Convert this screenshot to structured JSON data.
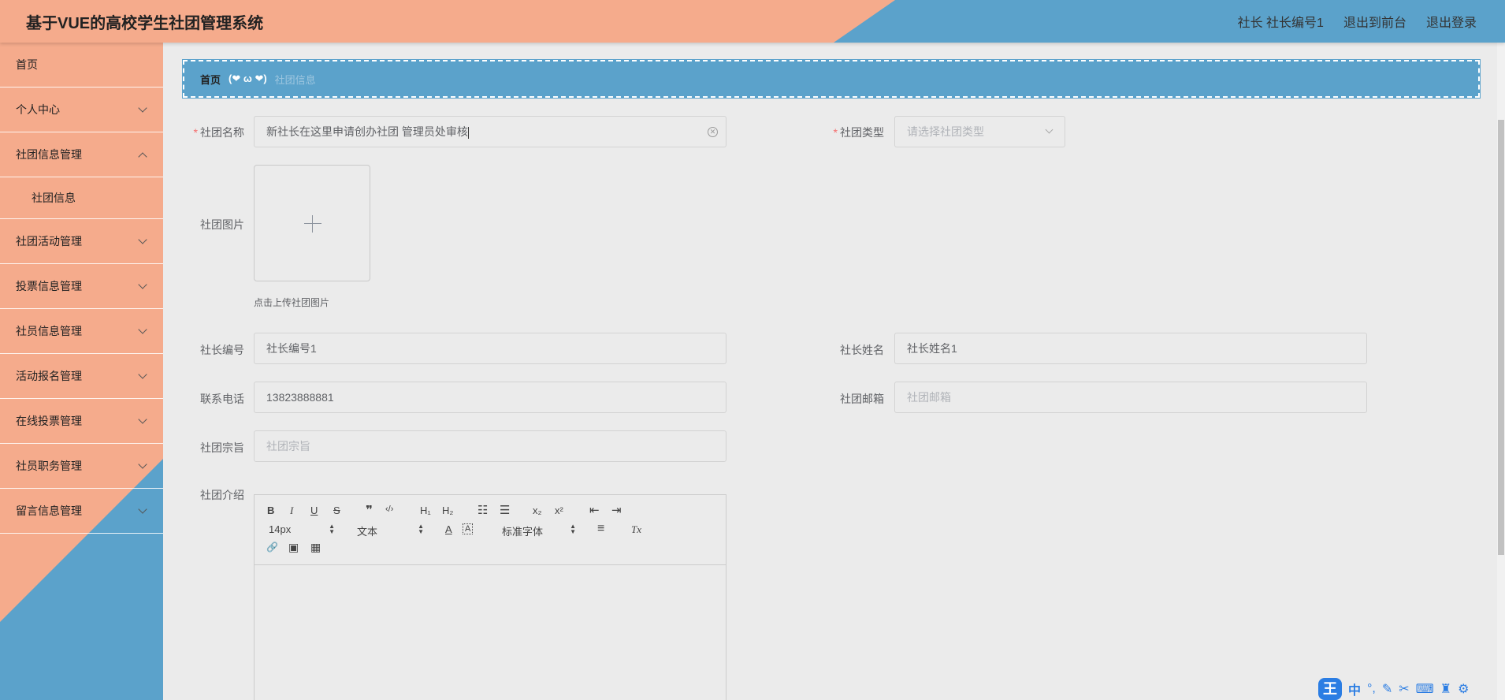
{
  "header": {
    "title": "基于VUE的高校学生社团管理系统",
    "user": "社长 社长编号1",
    "to_front": "退出到前台",
    "logout": "退出登录"
  },
  "sidebar": {
    "items": [
      {
        "label": "首页",
        "chevron": "none"
      },
      {
        "label": "个人中心",
        "chevron": "down"
      },
      {
        "label": "社团信息管理",
        "chevron": "up"
      },
      {
        "label": "社团信息",
        "chevron": "none",
        "sub": true
      },
      {
        "label": "社团活动管理",
        "chevron": "down"
      },
      {
        "label": "投票信息管理",
        "chevron": "down"
      },
      {
        "label": "社员信息管理",
        "chevron": "down"
      },
      {
        "label": "活动报名管理",
        "chevron": "down"
      },
      {
        "label": "在线投票管理",
        "chevron": "down"
      },
      {
        "label": "社员职务管理",
        "chevron": "down"
      },
      {
        "label": "留言信息管理",
        "chevron": "down"
      }
    ]
  },
  "breadcrumb": {
    "home": "首页",
    "deco": "(❤ ω ❤)",
    "current": "社团信息"
  },
  "form": {
    "club_name": {
      "label": "社团名称",
      "value": "新社长在这里申请创办社团 管理员处审核"
    },
    "club_type": {
      "label": "社团类型",
      "placeholder": "请选择社团类型"
    },
    "club_image": {
      "label": "社团图片",
      "tip": "点击上传社团图片"
    },
    "president_id": {
      "label": "社长编号",
      "value": "社长编号1"
    },
    "president_name": {
      "label": "社长姓名",
      "value": "社长姓名1"
    },
    "phone": {
      "label": "联系电话",
      "value": "13823888881"
    },
    "email": {
      "label": "社团邮箱",
      "placeholder": "社团邮箱"
    },
    "purpose": {
      "label": "社团宗旨",
      "placeholder": "社团宗旨"
    },
    "intro": {
      "label": "社团介绍"
    }
  },
  "editor": {
    "bold": "B",
    "italic": "I",
    "underline": "U",
    "strike": "S",
    "quote": "❞",
    "code": "‹/›",
    "h1": "H₁",
    "h2": "H₂",
    "ol": "☷",
    "ul": "☰",
    "sub": "x₂",
    "sup": "x²",
    "outdent": "⇤",
    "indent": "⇥",
    "size": "14px",
    "header": "文本",
    "font": "标准字体",
    "color": "A",
    "bg": "A",
    "align": "≡",
    "clean": "Tx",
    "link": "🔗",
    "image": "▣",
    "video": "▦"
  },
  "ime": {
    "mode": "中",
    "punct": "°,",
    "logo": "王"
  },
  "colors": {
    "salmon": "#f5ab8c",
    "blue": "#5ba2cb",
    "required": "#f56c6c"
  }
}
